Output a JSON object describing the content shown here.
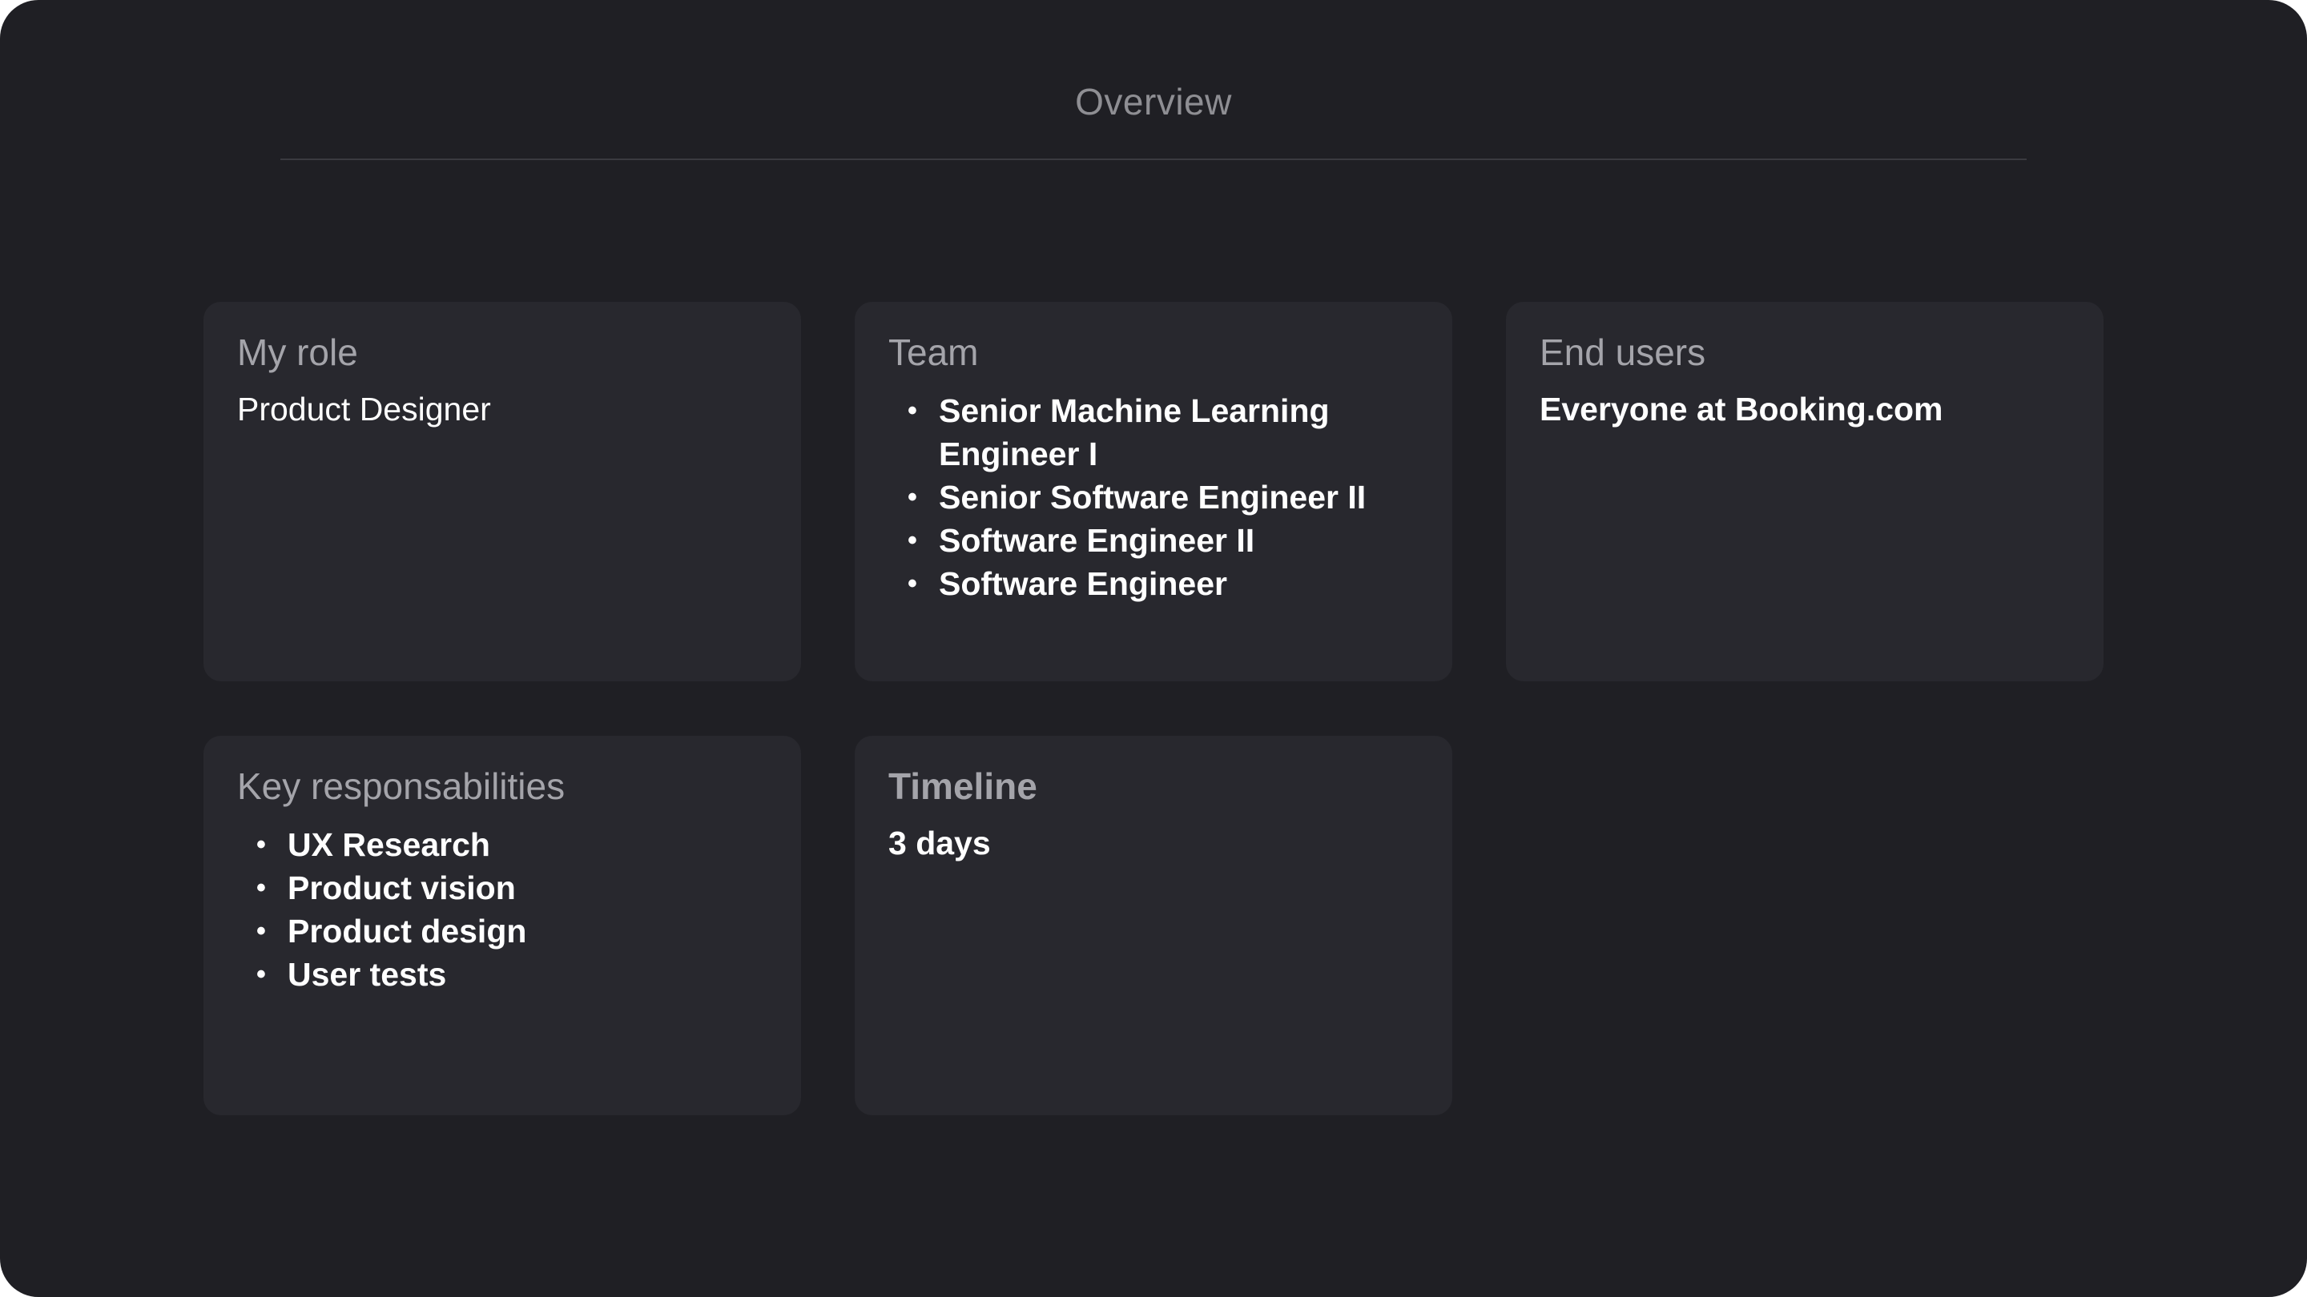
{
  "header": {
    "title": "Overview"
  },
  "cards": {
    "role": {
      "title": "My role",
      "value": "Product Designer"
    },
    "team": {
      "title": "Team",
      "items": [
        "Senior Machine Learning Engineer I",
        "Senior Software Engineer II",
        "Software Engineer II",
        "Software Engineer"
      ]
    },
    "end_users": {
      "title": "End users",
      "value": "Everyone at Booking.com"
    },
    "responsibilities": {
      "title": "Key responsabilities",
      "items": [
        "UX Research",
        "Product vision",
        "Product design",
        "User tests"
      ]
    },
    "timeline": {
      "title": "Timeline",
      "value": "3 days"
    }
  },
  "colors": {
    "background": "#1f1f24",
    "card": "#28282e",
    "title_text": "#a4a4aa",
    "body_text": "#ffffff"
  }
}
